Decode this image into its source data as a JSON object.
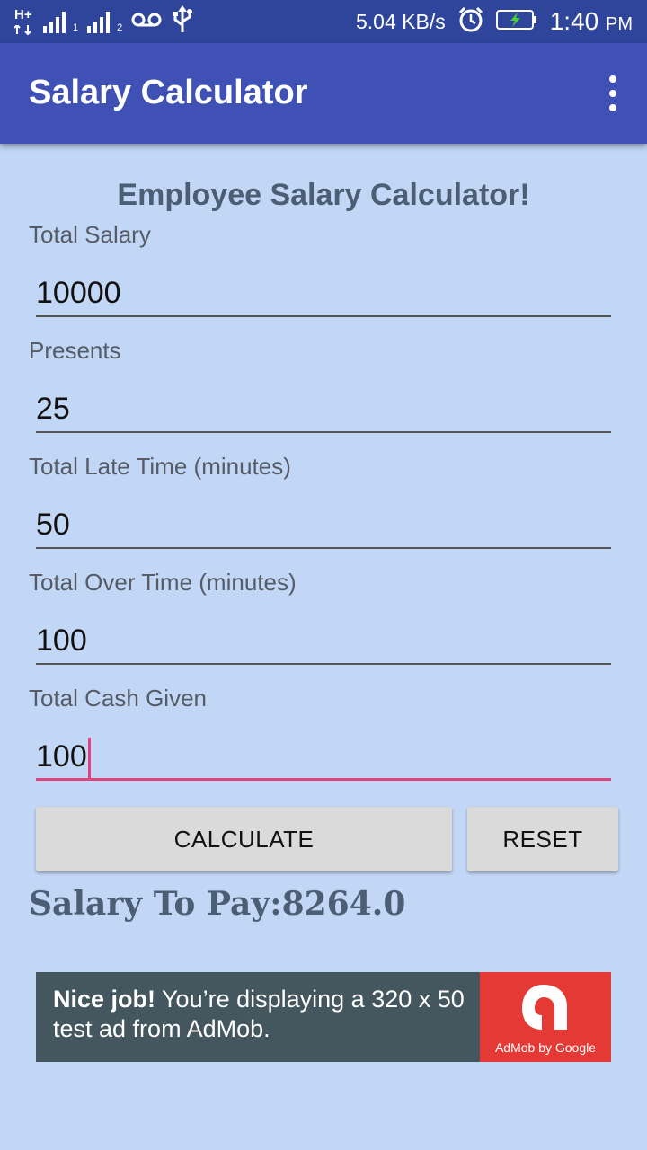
{
  "status_bar": {
    "network_1": "H+",
    "sim1": "1",
    "sim2": "2",
    "speed": "5.04 KB/s",
    "time": "1:40",
    "ampm": "PM"
  },
  "app_bar": {
    "title": "Salary Calculator"
  },
  "form": {
    "heading": "Employee Salary Calculator!",
    "total_salary": {
      "label": "Total Salary",
      "value": "10000"
    },
    "presents": {
      "label": "Presents",
      "value": "25"
    },
    "late_time": {
      "label": "Total Late Time (minutes)",
      "value": "50"
    },
    "over_time": {
      "label": "Total Over Time (minutes)",
      "value": "100"
    },
    "cash_given": {
      "label": "Total Cash Given",
      "value": "100"
    }
  },
  "buttons": {
    "calculate": "CALCULATE",
    "reset": "RESET"
  },
  "result": {
    "text": "Salary To Pay:8264.0"
  },
  "ad": {
    "bold": "Nice job!",
    "text": " You’re displaying a 320 x 50 test ad from AdMob.",
    "brand": "AdMob by Google"
  },
  "colors": {
    "background": "#c2d7f5",
    "app_bar": "#3f51b5",
    "status_bar": "#2f459c",
    "accent": "#e0447c",
    "ad_background": "#44565e",
    "ad_logo": "#e53935"
  }
}
